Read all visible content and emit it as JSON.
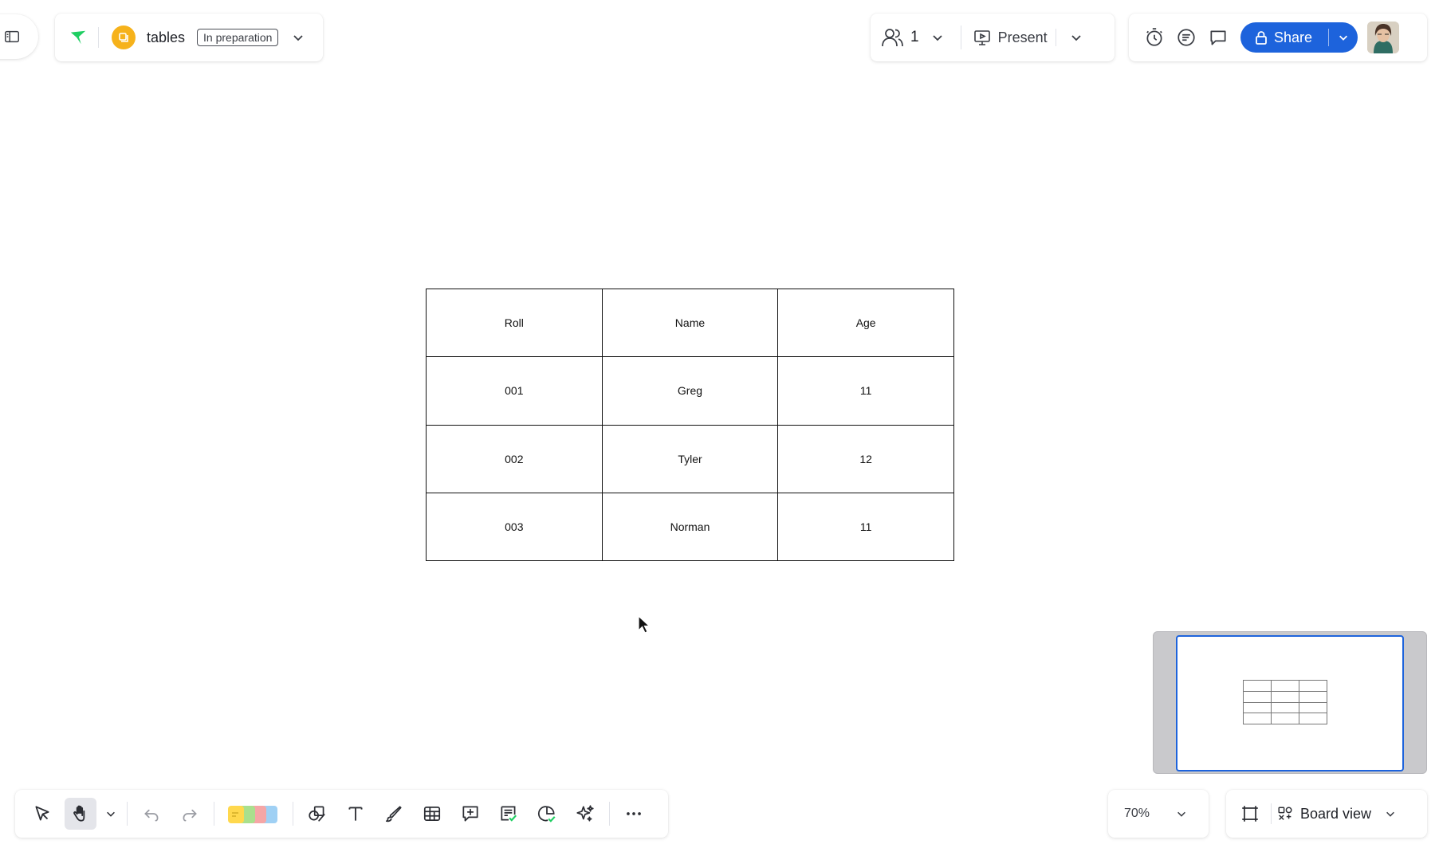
{
  "app": {
    "board_name": "tables",
    "board_status": "In preparation",
    "brand_color": "#1d63dc",
    "board_icon_color": "#f6b21b",
    "logo_color": "#1fce62"
  },
  "header": {
    "users_count": "1",
    "present_label": "Present",
    "share_label": "Share"
  },
  "table": {
    "rows": [
      [
        "Roll",
        "Name",
        "Age"
      ],
      [
        "001",
        "Greg",
        "11"
      ],
      [
        "002",
        "Tyler",
        "12"
      ],
      [
        "003",
        "Norman",
        "11"
      ]
    ]
  },
  "toolbar": {
    "tools": [
      "select-icon",
      "hand-icon",
      "undo-icon",
      "redo-icon",
      "sticky-notes-icon",
      "shapes-icon",
      "text-icon",
      "pen-icon",
      "table-icon",
      "comment-icon",
      "template-icon",
      "diagram-icon",
      "ai-sparkle-icon",
      "more-icon"
    ],
    "active_tool": "hand"
  },
  "footer": {
    "zoom_label": "70%",
    "view_label": "Board view"
  }
}
